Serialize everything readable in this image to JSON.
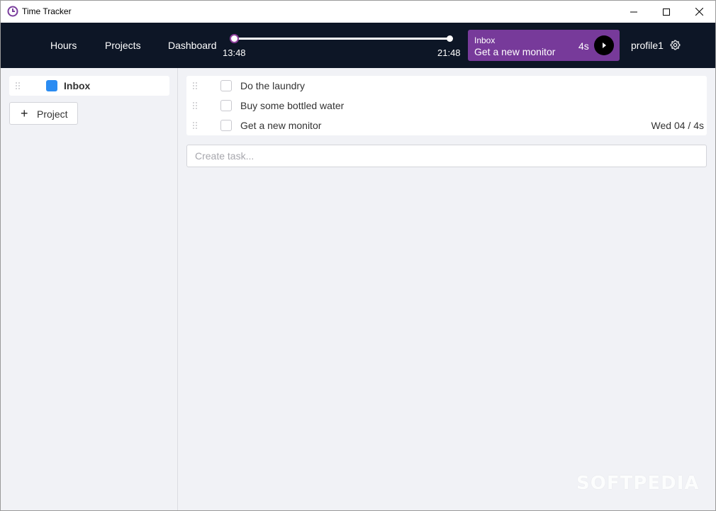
{
  "window": {
    "title": "Time Tracker"
  },
  "nav": {
    "items": [
      {
        "label": "Hours"
      },
      {
        "label": "Projects"
      },
      {
        "label": "Dashboard"
      }
    ]
  },
  "timeline": {
    "start_time": "13:48",
    "end_time": "21:48"
  },
  "active_task": {
    "project": "Inbox",
    "name": "Get a new monitor",
    "duration": "4s",
    "background_color": "#773a9a"
  },
  "profile": {
    "name": "profile1"
  },
  "sidebar": {
    "projects": [
      {
        "name": "Inbox",
        "color": "#2b8cf2"
      }
    ],
    "add_project_label": "Project"
  },
  "tasks": [
    {
      "name": "Do the laundry",
      "meta": ""
    },
    {
      "name": "Buy some bottled water",
      "meta": ""
    },
    {
      "name": "Get a new monitor",
      "meta": "Wed 04 / 4s"
    }
  ],
  "create_task": {
    "placeholder": "Create task..."
  },
  "watermark": "SOFTPEDIA"
}
